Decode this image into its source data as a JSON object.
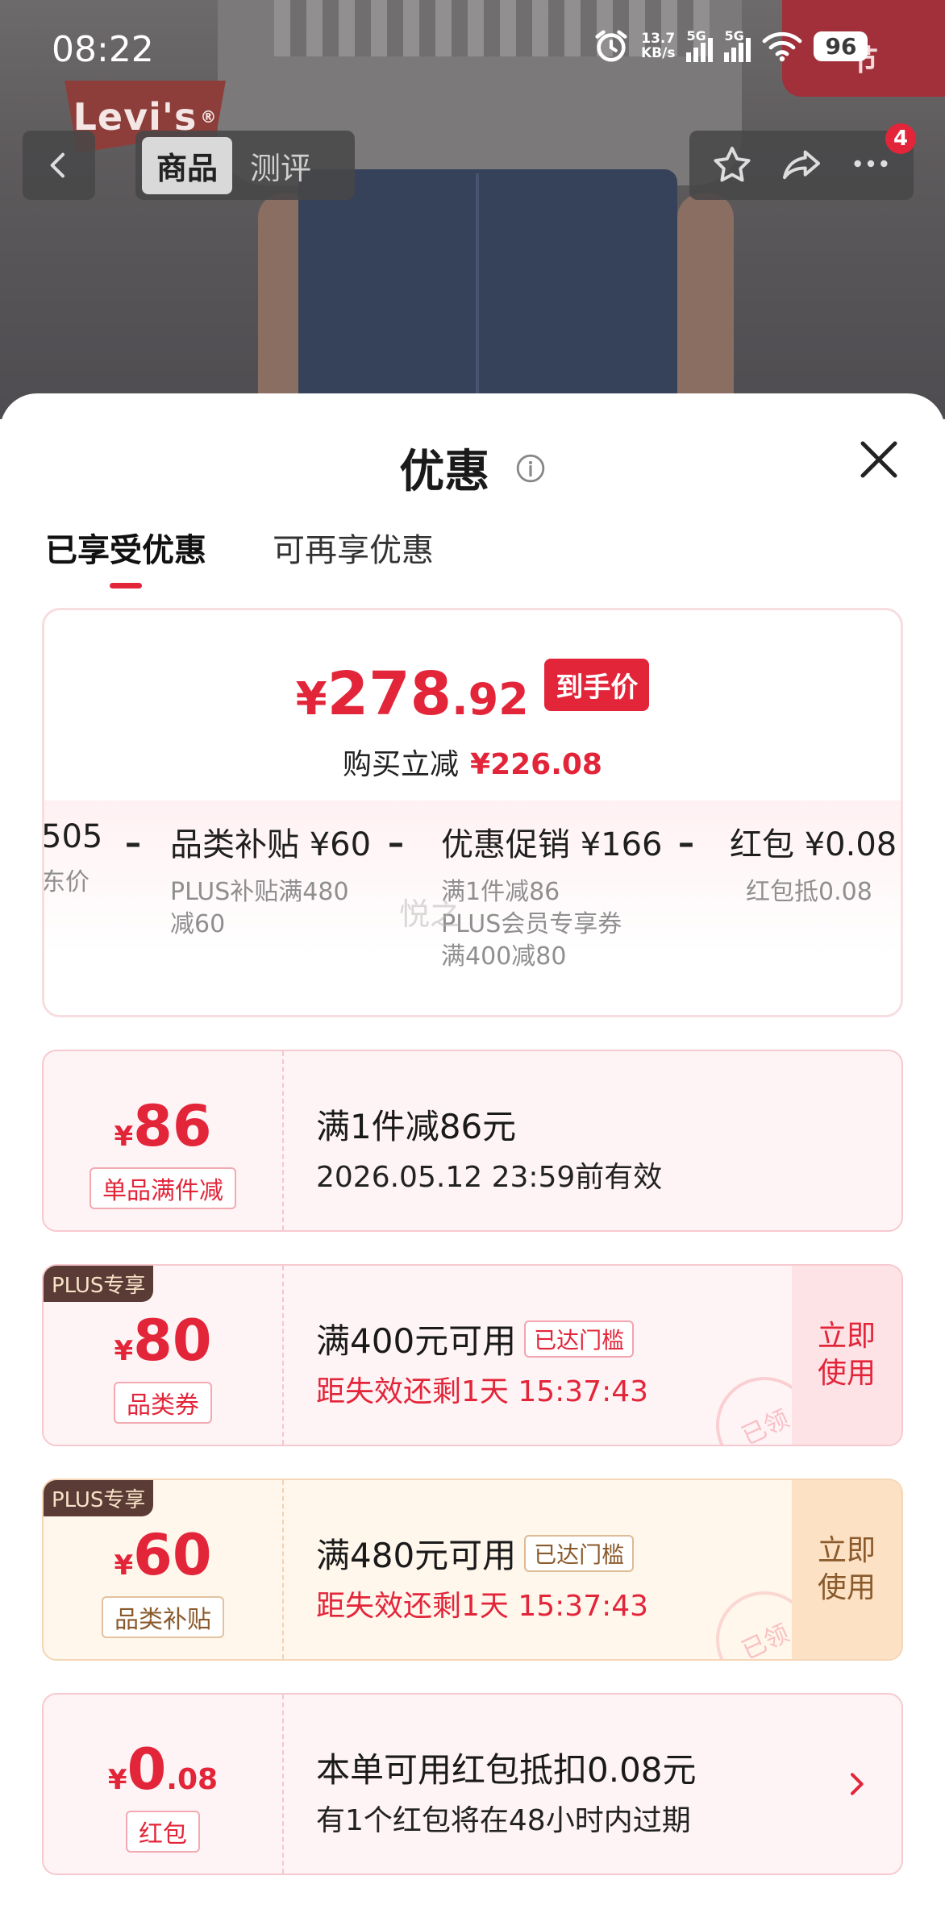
{
  "status_bar": {
    "time": "08:22",
    "net_speed_value": "13.7",
    "net_speed_unit": "KB/s",
    "signal1_label": "5G",
    "signal2_label": "5G",
    "battery": "96"
  },
  "hero": {
    "brand_logo": "Levi's",
    "promo_badge": "节"
  },
  "nav": {
    "tabs": [
      {
        "label": "商品",
        "active": true
      },
      {
        "label": "测评",
        "active": false
      }
    ],
    "more_badge": "4"
  },
  "sheet": {
    "title": "优惠",
    "tabs": [
      {
        "label": "已享受优惠",
        "active": true
      },
      {
        "label": "可再享优惠",
        "active": false
      }
    ]
  },
  "summary": {
    "price_yen": "¥",
    "price_int": "278",
    "price_dec": ".92",
    "price_tag": "到手价",
    "reduce_label": "购买立减",
    "reduce_amount": "¥226.08",
    "breakdown": [
      {
        "head": "505",
        "sub": [
          "东价"
        ]
      },
      {
        "head": "品类补贴 ¥60",
        "sub": [
          "PLUS补贴满480",
          "减60"
        ]
      },
      {
        "head": "优惠促销 ¥166",
        "sub": [
          "满1件减86",
          "PLUS会员专享券",
          "满400减80"
        ]
      },
      {
        "head": "红包 ¥0.08",
        "sub": [
          "红包抵0.08"
        ]
      }
    ],
    "minus_sign": "–",
    "watermark": "悦之"
  },
  "coupons": [
    {
      "plus": null,
      "yen": "¥",
      "big": "86",
      "small": "",
      "type": "单品满件减",
      "cond": "满1件减86元",
      "reached": null,
      "sub": "2026.05.12 23:59前有效",
      "sub_red": false,
      "use": null,
      "stamp": null
    },
    {
      "plus": "PLUS专享",
      "yen": "¥",
      "big": "80",
      "small": "",
      "type": "品类券",
      "cond": "满400元可用",
      "reached": "已达门槛",
      "sub": "距失效还剩1天 15:37:43",
      "sub_red": true,
      "use": "立即\n使用",
      "stamp": "已领"
    },
    {
      "plus": "PLUS专享",
      "yen": "¥",
      "big": "60",
      "small": "",
      "type": "品类补贴",
      "cond": "满480元可用",
      "reached": "已达门槛",
      "sub": "距失效还剩1天 15:37:43",
      "sub_red": true,
      "use": "立即\n使用",
      "stamp": "已领"
    },
    {
      "plus": null,
      "yen": "¥",
      "big": "0",
      "small": ".08",
      "type": "红包",
      "cond": "本单可用红包抵扣0.08元",
      "reached": null,
      "sub": "有1个红包将在48小时内过期",
      "sub_red": false,
      "use": null,
      "stamp": null
    }
  ],
  "colors": {
    "accent": "#e3253a",
    "gold_text": "#8a5a2c"
  }
}
